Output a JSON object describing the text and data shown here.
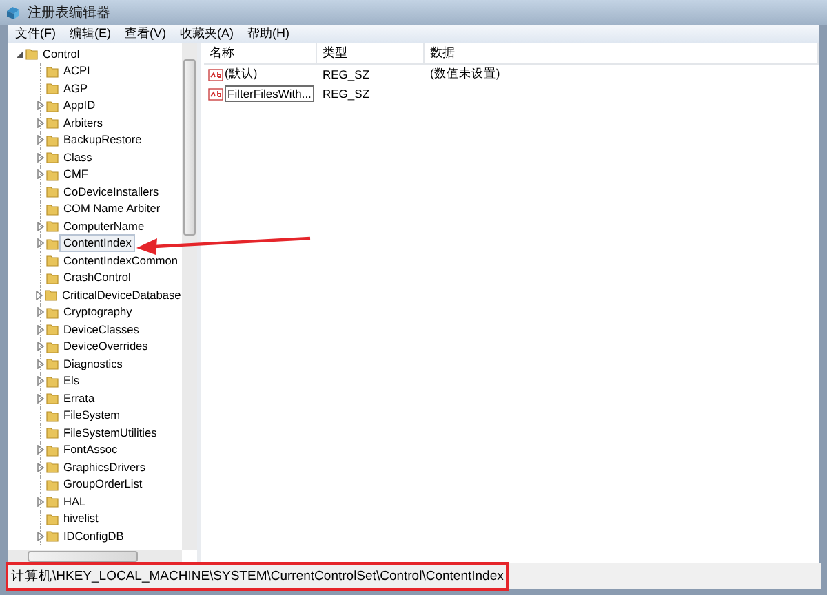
{
  "window": {
    "title": "注册表编辑器"
  },
  "menu": [
    "文件(F)",
    "编辑(E)",
    "查看(V)",
    "收藏夹(A)",
    "帮助(H)"
  ],
  "tree": {
    "label": "Control",
    "expanded": true,
    "children": [
      {
        "label": "ACPI",
        "expandable": false,
        "selected": false
      },
      {
        "label": "AGP",
        "expandable": false,
        "selected": false
      },
      {
        "label": "AppID",
        "expandable": true,
        "selected": false
      },
      {
        "label": "Arbiters",
        "expandable": true,
        "selected": false
      },
      {
        "label": "BackupRestore",
        "expandable": true,
        "selected": false
      },
      {
        "label": "Class",
        "expandable": true,
        "selected": false
      },
      {
        "label": "CMF",
        "expandable": true,
        "selected": false
      },
      {
        "label": "CoDeviceInstallers",
        "expandable": false,
        "selected": false
      },
      {
        "label": "COM Name Arbiter",
        "expandable": false,
        "selected": false
      },
      {
        "label": "ComputerName",
        "expandable": true,
        "selected": false
      },
      {
        "label": "ContentIndex",
        "expandable": true,
        "selected": true
      },
      {
        "label": "ContentIndexCommon",
        "expandable": false,
        "selected": false
      },
      {
        "label": "CrashControl",
        "expandable": false,
        "selected": false
      },
      {
        "label": "CriticalDeviceDatabase",
        "expandable": true,
        "selected": false
      },
      {
        "label": "Cryptography",
        "expandable": true,
        "selected": false
      },
      {
        "label": "DeviceClasses",
        "expandable": true,
        "selected": false
      },
      {
        "label": "DeviceOverrides",
        "expandable": true,
        "selected": false
      },
      {
        "label": "Diagnostics",
        "expandable": true,
        "selected": false
      },
      {
        "label": "Els",
        "expandable": true,
        "selected": false
      },
      {
        "label": "Errata",
        "expandable": true,
        "selected": false
      },
      {
        "label": "FileSystem",
        "expandable": false,
        "selected": false
      },
      {
        "label": "FileSystemUtilities",
        "expandable": false,
        "selected": false
      },
      {
        "label": "FontAssoc",
        "expandable": true,
        "selected": false
      },
      {
        "label": "GraphicsDrivers",
        "expandable": true,
        "selected": false
      },
      {
        "label": "GroupOrderList",
        "expandable": false,
        "selected": false
      },
      {
        "label": "HAL",
        "expandable": true,
        "selected": false
      },
      {
        "label": "hivelist",
        "expandable": false,
        "selected": false
      },
      {
        "label": "IDConfigDB",
        "expandable": true,
        "selected": false
      }
    ]
  },
  "values": {
    "columns": [
      "名称",
      "类型",
      "数据"
    ],
    "rows": [
      {
        "name": "(默认)",
        "type": "REG_SZ",
        "data": "(数值未设置)",
        "editing": false
      },
      {
        "name": "FilterFilesWith...",
        "type": "REG_SZ",
        "editing": true
      }
    ]
  },
  "annotation": {
    "arrow": true
  },
  "status_bar": {
    "path": "计算机\\HKEY_LOCAL_MACHINE\\SYSTEM\\CurrentControlSet\\Control\\ContentIndex",
    "highlighted": true
  }
}
